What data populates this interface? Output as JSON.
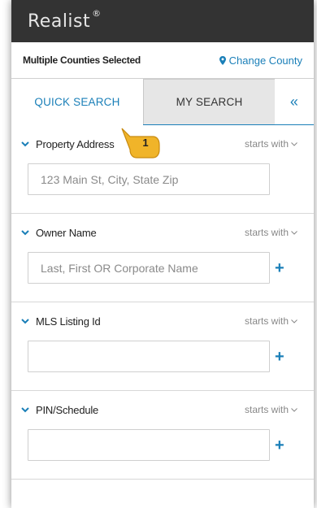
{
  "header": {
    "brand": "Realist",
    "brand_mark": "®"
  },
  "county_bar": {
    "label": "Multiple Counties Selected",
    "link": "Change County"
  },
  "tabs": [
    {
      "label": "QUICK SEARCH",
      "active": true
    },
    {
      "label": "MY SEARCH",
      "active": false
    },
    {
      "label": "«"
    }
  ],
  "callout": {
    "number": "1"
  },
  "sections": [
    {
      "title": "Property Address",
      "mode": "starts with",
      "placeholder": "123 Main St, City, State Zip",
      "value": "",
      "has_add": false
    },
    {
      "title": "Owner Name",
      "mode": "starts with",
      "placeholder": "Last, First OR Corporate Name",
      "value": "",
      "has_add": true,
      "add_label": "+"
    },
    {
      "title": "MLS Listing Id",
      "mode": "starts with",
      "placeholder": "",
      "value": "",
      "has_add": true,
      "add_label": "+"
    },
    {
      "title": "PIN/Schedule",
      "mode": "starts with",
      "placeholder": "",
      "value": "",
      "has_add": true,
      "add_label": "+"
    }
  ],
  "colors": {
    "accent": "#1a7fb8",
    "header_bg": "#333333",
    "tab_inactive_bg": "#e6e6e6",
    "badge": "#f0b429"
  },
  "icons": {
    "county": "map-pin-icon",
    "section_toggle": "chevron-down-icon",
    "collapse": "double-chevron-left-icon",
    "add": "plus-icon"
  }
}
